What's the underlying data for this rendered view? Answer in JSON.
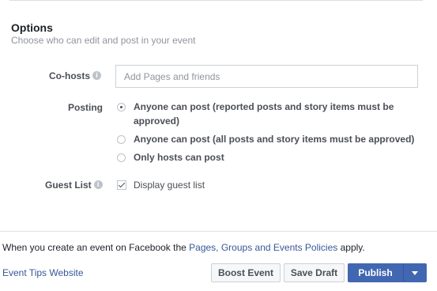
{
  "options": {
    "title": "Options",
    "subtitle": "Choose who can edit and post in your event"
  },
  "cohosts": {
    "label": "Co-hosts",
    "placeholder": "Add Pages and friends",
    "value": ""
  },
  "posting": {
    "label": "Posting",
    "options": [
      {
        "line1": "Anyone can post (reported posts and story items must be",
        "line2": "approved)",
        "selected": true
      },
      {
        "line1": "Anyone can post (all posts and story items must be approved)",
        "selected": false
      },
      {
        "line1": "Only hosts can post",
        "selected": false
      }
    ]
  },
  "guest_list": {
    "label": "Guest List",
    "checkbox_label": "Display guest list",
    "checked": true
  },
  "footer": {
    "policy_prefix": "When you create an event on Facebook the ",
    "policy_link": "Pages, Groups and Events Policies",
    "policy_suffix": " apply.",
    "tips_link": "Event Tips Website"
  },
  "buttons": {
    "boost": "Boost Event",
    "save_draft": "Save Draft",
    "publish": "Publish"
  },
  "icons": {
    "info": "info-icon",
    "dropdown": "caret-down-icon"
  },
  "colors": {
    "primary": "#4267b2",
    "link": "#365899",
    "muted": "#90949c"
  }
}
